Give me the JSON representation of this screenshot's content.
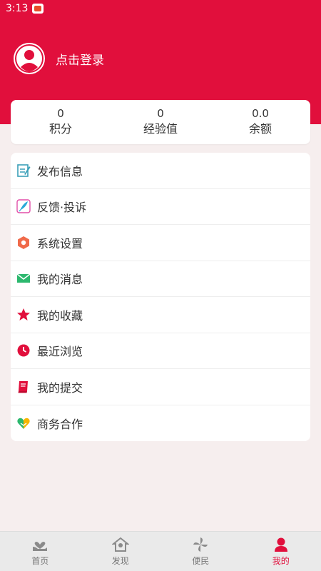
{
  "status_bar": {
    "time": "3:13"
  },
  "profile": {
    "login_text": "点击登录"
  },
  "stats": [
    {
      "value": "0",
      "label": "积分"
    },
    {
      "value": "0",
      "label": "经验值"
    },
    {
      "value": "0.0",
      "label": "余额"
    }
  ],
  "menu": [
    {
      "label": "发布信息",
      "icon": "edit-icon"
    },
    {
      "label": "反馈·投诉",
      "icon": "feather-icon"
    },
    {
      "label": "系统设置",
      "icon": "settings-icon"
    },
    {
      "label": "我的消息",
      "icon": "mail-icon"
    },
    {
      "label": "我的收藏",
      "icon": "star-icon"
    },
    {
      "label": "最近浏览",
      "icon": "clock-icon"
    },
    {
      "label": "我的提交",
      "icon": "book-icon"
    },
    {
      "label": "商务合作",
      "icon": "handshake-heart-icon"
    }
  ],
  "tabs": [
    {
      "label": "首页",
      "icon": "heart-hand-icon",
      "active": false
    },
    {
      "label": "发现",
      "icon": "house-pin-icon",
      "active": false
    },
    {
      "label": "便民",
      "icon": "pinwheel-icon",
      "active": false
    },
    {
      "label": "我的",
      "icon": "person-icon",
      "active": true
    }
  ],
  "colors": {
    "brand": "#e10f3c",
    "background": "#f6eeee",
    "tabbar": "#eaeaea"
  }
}
